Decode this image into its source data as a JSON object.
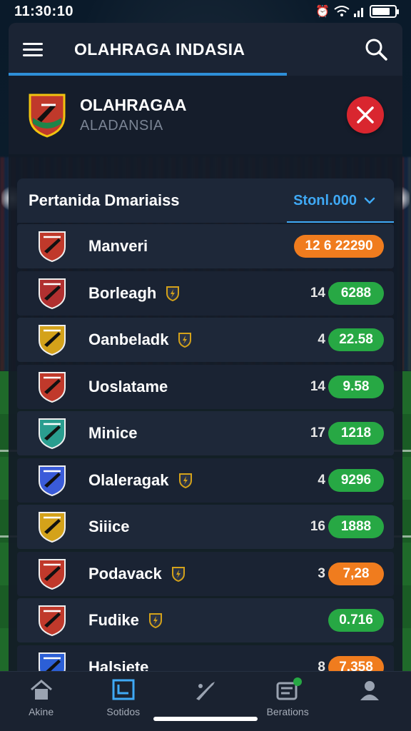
{
  "status_bar": {
    "time": "11:30:10"
  },
  "top_bar": {
    "title": "OLAHRAGA INDASIA"
  },
  "league": {
    "name": "OLAHRAGAA",
    "subtitle": "ALADANSIA"
  },
  "table": {
    "title": "Pertanida Dmariaiss",
    "sort_label": "Stonl.000",
    "rows": [
      {
        "name": "Manveri",
        "rank": "",
        "score": "12 6 22290",
        "pill": "orange",
        "badge": false,
        "crest": "#c0392b"
      },
      {
        "name": "Borleagh",
        "rank": "14",
        "score": "6288",
        "pill": "green",
        "badge": true,
        "crest": "#b03030"
      },
      {
        "name": "Oanbeladk",
        "rank": "4",
        "score": "22.58",
        "pill": "green",
        "badge": true,
        "crest": "#d4a21a"
      },
      {
        "name": "Uoslatame",
        "rank": "14",
        "score": "9.58",
        "pill": "green",
        "badge": false,
        "crest": "#c0392b"
      },
      {
        "name": "Minice",
        "rank": "17",
        "score": "1218",
        "pill": "green",
        "badge": false,
        "crest": "#2a9d8f"
      },
      {
        "name": "Olaleragak",
        "rank": "4",
        "score": "9296",
        "pill": "green",
        "badge": true,
        "crest": "#3a5bd9"
      },
      {
        "name": "Siiice",
        "rank": "16",
        "score": "1888",
        "pill": "green",
        "badge": false,
        "crest": "#d4a21a"
      },
      {
        "name": "Podavack",
        "rank": "3",
        "score": "7,28",
        "pill": "orange",
        "badge": true,
        "crest": "#c0392b"
      },
      {
        "name": "Fudike",
        "rank": "",
        "score": "0.716",
        "pill": "green",
        "badge": true,
        "crest": "#c0392b"
      },
      {
        "name": "Halsiete",
        "rank": "8",
        "score": "7,358",
        "pill": "orange",
        "badge": false,
        "crest": "#2c5fd6"
      }
    ]
  },
  "nav": [
    {
      "label": "Akine",
      "icon": "home-icon"
    },
    {
      "label": "Sotidos",
      "icon": "standings-icon"
    },
    {
      "label": "",
      "icon": "sports-icon"
    },
    {
      "label": "Berations",
      "icon": "stats-icon"
    },
    {
      "label": "",
      "icon": "profile-icon"
    }
  ],
  "colors": {
    "accent": "#3fa9f5",
    "close": "#d9262f",
    "green": "#27a844",
    "orange": "#f07c1e"
  }
}
